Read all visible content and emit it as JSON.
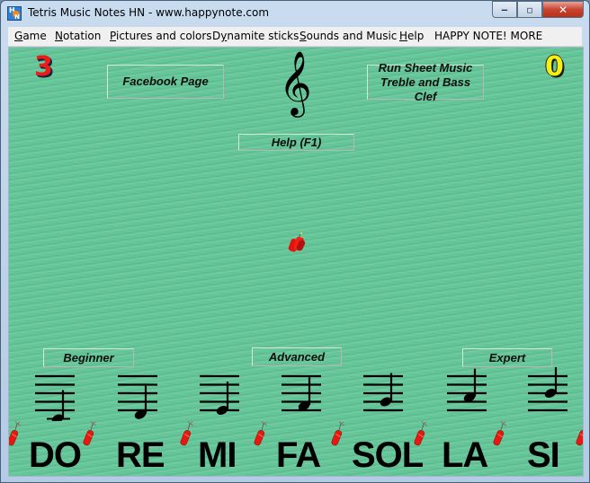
{
  "window": {
    "title": "Tetris Music Notes HN - www.happynote.com",
    "icon": "happynote-app-icon",
    "controls": {
      "minimize": "minimize-icon",
      "maximize": "maximize-icon",
      "close": "close-icon"
    }
  },
  "menu": [
    {
      "label": "Game",
      "accel": "G",
      "rest": "ame"
    },
    {
      "label": "Notation",
      "accel": "N",
      "rest": "otation"
    },
    {
      "label": "Pictures and colors",
      "accel": "P",
      "rest": "ictures and colors"
    },
    {
      "label": "Dynamite sticks",
      "pre": "D",
      "accel": "y",
      "rest": "namite sticks"
    },
    {
      "label": "Sounds and Music",
      "accel": "S",
      "rest": "ounds and Music"
    },
    {
      "label": "Help",
      "accel": "H",
      "rest": "elp"
    },
    {
      "label": "HAPPY NOTE! MORE",
      "accel": "",
      "rest": "HAPPY NOTE! MORE"
    }
  ],
  "game": {
    "score_left": "3",
    "score_right": "0",
    "colors": {
      "background": "#63c597",
      "score_left": "#ee1b1b",
      "score_right": "#f4ee17"
    },
    "buttons": {
      "facebook": "Facebook Page",
      "run_sheet_line1": "Run Sheet Music",
      "run_sheet_line2": "Treble and Bass Clef",
      "help": "Help (F1)",
      "beginner": "Beginner",
      "advanced": "Advanced",
      "expert": "Expert"
    },
    "clef_icon": "treble-clef-icon",
    "falling_piece": "dynamite-bundle-icon",
    "notes": [
      {
        "name": "DO",
        "position": "ledger-below"
      },
      {
        "name": "RE",
        "position": "below-line-1"
      },
      {
        "name": "MI",
        "position": "line-1"
      },
      {
        "name": "FA",
        "position": "space-1"
      },
      {
        "name": "SOL",
        "position": "line-2"
      },
      {
        "name": "LA",
        "position": "space-2"
      },
      {
        "name": "SI",
        "position": "line-3"
      }
    ]
  }
}
